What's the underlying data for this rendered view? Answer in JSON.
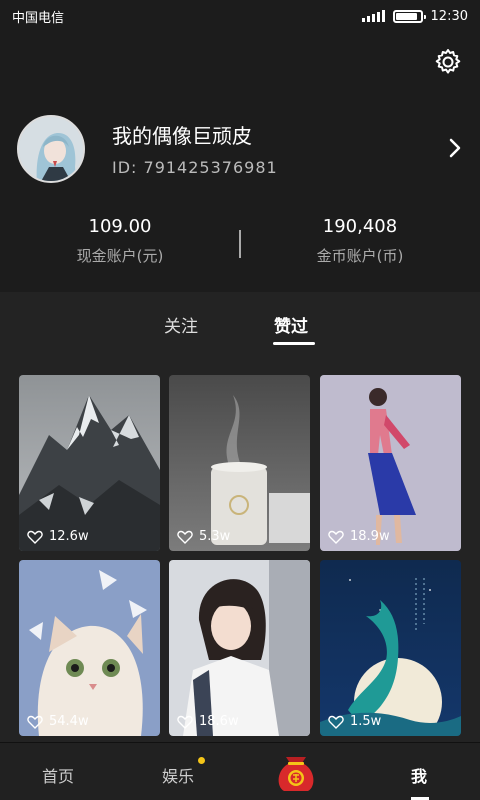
{
  "status_bar": {
    "carrier": "中国电信",
    "time": "12:30"
  },
  "profile": {
    "name": "我的偶像巨顽皮",
    "id_text": "ID: 791425376981"
  },
  "accounts": [
    {
      "value": "109.00",
      "label": "现金账户(元)"
    },
    {
      "value": "190,408",
      "label": "金币账户(币)"
    }
  ],
  "tabs": [
    {
      "label": "关注",
      "active": false
    },
    {
      "label": "赞过",
      "active": true
    }
  ],
  "cards": [
    {
      "subject": "mountain",
      "likes": "12.6w"
    },
    {
      "subject": "humidifier",
      "likes": "5.3w"
    },
    {
      "subject": "woman-qipao",
      "likes": "18.9w"
    },
    {
      "subject": "cat",
      "likes": "54.4w"
    },
    {
      "subject": "woman-portrait",
      "likes": "18.6w"
    },
    {
      "subject": "whale-moon",
      "likes": "1.5w"
    }
  ],
  "bottom_nav": [
    {
      "label": "首页",
      "active": false
    },
    {
      "label": "娱乐",
      "active": false,
      "badge": true
    },
    {
      "label": "我",
      "active": true
    }
  ],
  "colors": {
    "background": "#1c1c1c",
    "content": "#232323",
    "badge": "#f5c518",
    "bag": "#d8292b"
  }
}
